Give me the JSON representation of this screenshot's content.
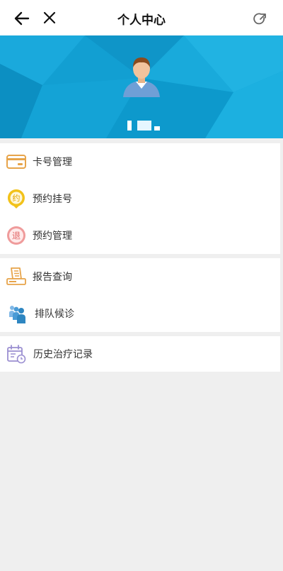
{
  "header": {
    "title": "个人中心",
    "back_icon": "arrow-left-icon",
    "close_icon": "close-icon",
    "share_icon": "share-icon"
  },
  "profile": {
    "name": "",
    "banner_color": "#0f9fd4",
    "avatar_icon": "user-avatar-icon"
  },
  "menu": {
    "group1": [
      {
        "label": "卡号管理",
        "icon": "card-icon"
      },
      {
        "label": "预约挂号",
        "icon": "appointment-badge-icon",
        "icon_text": "约"
      },
      {
        "label": "预约管理",
        "icon": "cancel-badge-icon",
        "icon_text": "退"
      }
    ],
    "group2": [
      {
        "label": "报告查询",
        "icon": "report-printer-icon"
      },
      {
        "label": "排队候诊",
        "icon": "queue-people-icon"
      }
    ],
    "group3": [
      {
        "label": "历史治疗记录",
        "icon": "calendar-clock-icon"
      }
    ]
  },
  "colors": {
    "card": "#e7a44a",
    "appointment": "#f2c21a",
    "cancel": "#ef9b9b",
    "report": "#e7a44a",
    "queue": "#2e86c1",
    "history": "#9b8fd1"
  }
}
